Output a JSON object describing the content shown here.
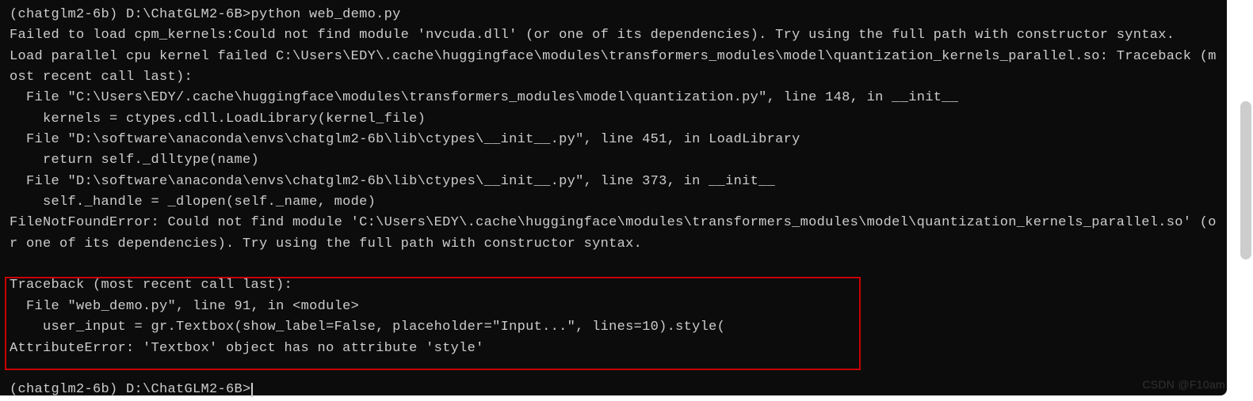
{
  "terminal": {
    "lines": [
      "(chatglm2-6b) D:\\ChatGLM2-6B>python web_demo.py",
      "Failed to load cpm_kernels:Could not find module 'nvcuda.dll' (or one of its dependencies). Try using the full path with constructor syntax.",
      "Load parallel cpu kernel failed C:\\Users\\EDY\\.cache\\huggingface\\modules\\transformers_modules\\model\\quantization_kernels_parallel.so: Traceback (most recent call last):",
      "  File \"C:\\Users\\EDY/.cache\\huggingface\\modules\\transformers_modules\\model\\quantization.py\", line 148, in __init__",
      "    kernels = ctypes.cdll.LoadLibrary(kernel_file)",
      "  File \"D:\\software\\anaconda\\envs\\chatglm2-6b\\lib\\ctypes\\__init__.py\", line 451, in LoadLibrary",
      "    return self._dlltype(name)",
      "  File \"D:\\software\\anaconda\\envs\\chatglm2-6b\\lib\\ctypes\\__init__.py\", line 373, in __init__",
      "    self._handle = _dlopen(self._name, mode)",
      "FileNotFoundError: Could not find module 'C:\\Users\\EDY\\.cache\\huggingface\\modules\\transformers_modules\\model\\quantization_kernels_parallel.so' (or one of its dependencies). Try using the full path with constructor syntax.",
      "",
      "Traceback (most recent call last):",
      "  File \"web_demo.py\", line 91, in <module>",
      "    user_input = gr.Textbox(show_label=False, placeholder=\"Input...\", lines=10).style(",
      "AttributeError: 'Textbox' object has no attribute 'style'",
      "",
      "(chatglm2-6b) D:\\ChatGLM2-6B>"
    ]
  },
  "watermark": "CSDN @F10am"
}
